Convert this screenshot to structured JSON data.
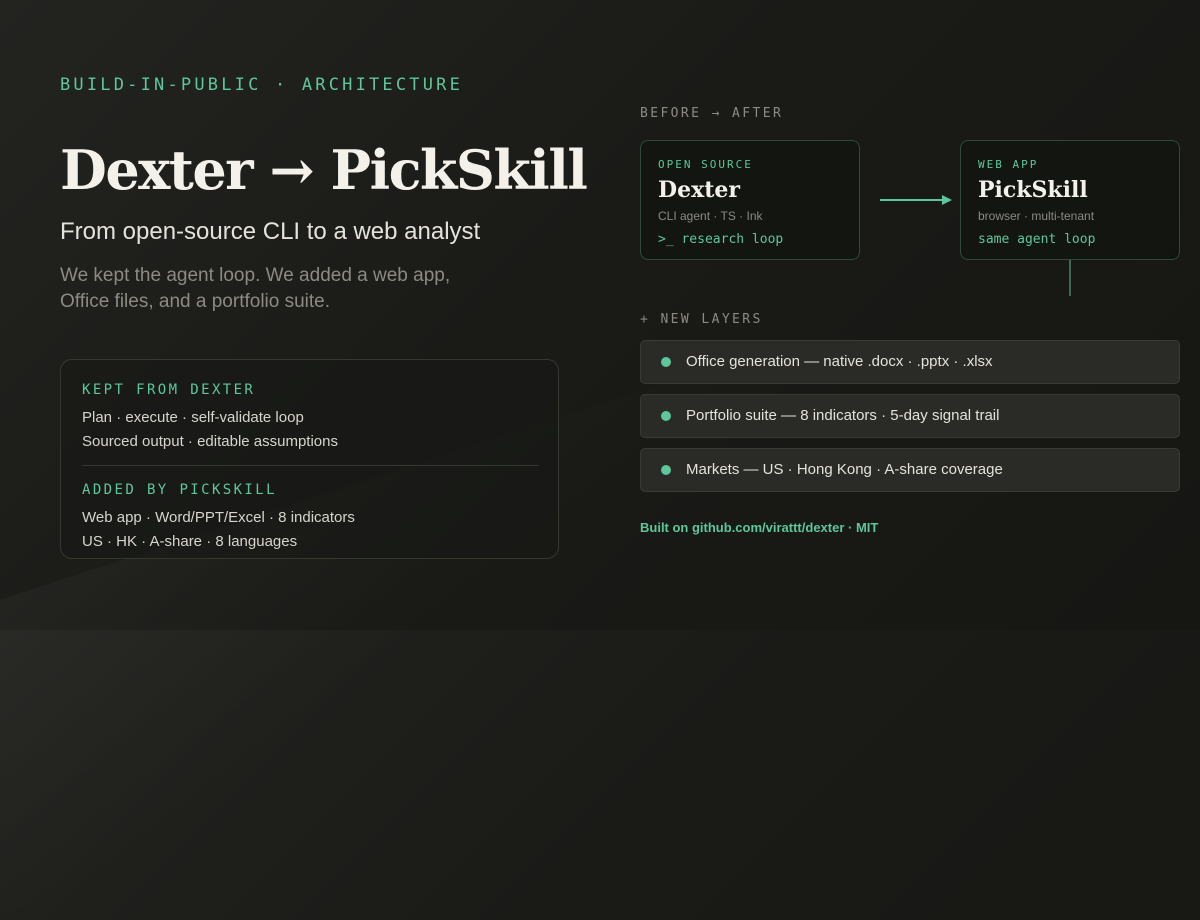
{
  "eyebrow": "BUILD-IN-PUBLIC · ARCHITECTURE",
  "title": "Dexter → PickSkill",
  "subtitle": "From open-source CLI to a web analyst",
  "lede": "We kept the agent loop. We added a web app, Office files, and a portfolio suite.",
  "kept_box": {
    "kept_label": "KEPT FROM DEXTER",
    "kept_lines": [
      "Plan · execute · self-validate loop",
      "Sourced output · editable assumptions"
    ],
    "added_label": "ADDED BY PICKSKILL",
    "added_lines": [
      "Web app · Word/PPT/Excel · 8 indicators",
      "US · HK · A-share · 8 languages"
    ]
  },
  "diagram": {
    "before_after_label": "BEFORE → AFTER",
    "before": {
      "tag": "OPEN SOURCE",
      "name": "Dexter",
      "meta": "CLI agent · TS · Ink",
      "loop": ">_ research loop"
    },
    "after": {
      "tag": "WEB APP",
      "name": "PickSkill",
      "meta": "browser · multi-tenant",
      "loop": "same agent loop"
    },
    "new_layers_label": "+ NEW LAYERS",
    "layers": [
      "Office generation — native .docx · .pptx · .xlsx",
      "Portfolio suite — 8 indicators · 5-day signal trail",
      "Markets — US · Hong Kong · A-share coverage"
    ]
  },
  "footer": "Built on github.com/virattt/dexter · MIT",
  "colors": {
    "accent": "#5cc79a",
    "background": "#1a1a17",
    "card_border": "#2f4a3c"
  }
}
